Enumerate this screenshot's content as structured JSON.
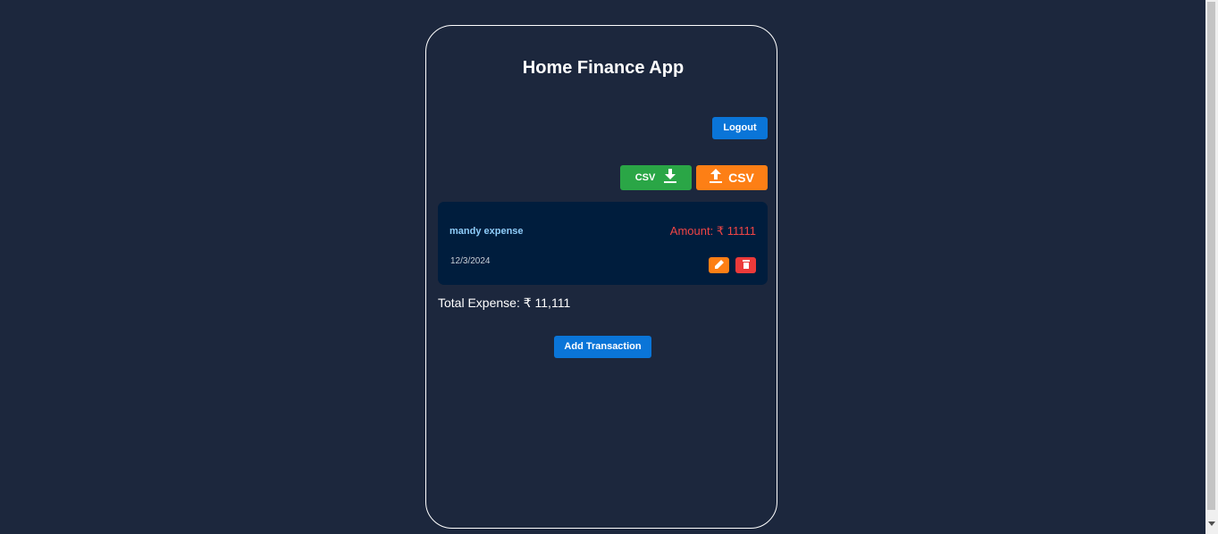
{
  "app": {
    "title": "Home Finance App"
  },
  "header": {
    "logout_label": "Logout"
  },
  "toolbar": {
    "csv_download_label": "CSV",
    "csv_upload_label": "CSV",
    "csv_download_icon": "download-icon",
    "csv_upload_icon": "upload-icon"
  },
  "transactions": [
    {
      "name": "mandy expense",
      "amount_text": "Amount: ₹ 11111",
      "date": "12/3/2024",
      "edit_icon": "pencil-icon",
      "delete_icon": "trash-icon"
    }
  ],
  "summary": {
    "total_expense_text": "Total Expense: ₹ 11,111"
  },
  "actions": {
    "add_transaction_label": "Add Transaction"
  },
  "colors": {
    "background": "#1c273d",
    "card_border": "#ffffff",
    "primary_button": "#0a75d8",
    "csv_download_button": "#2aa646",
    "csv_upload_button": "#fd7f15",
    "transaction_card": "#001d3d",
    "transaction_name": "#8fcdfa",
    "amount_text": "#f04545",
    "edit_button": "#fd7f15",
    "delete_button": "#ec3a3a"
  }
}
